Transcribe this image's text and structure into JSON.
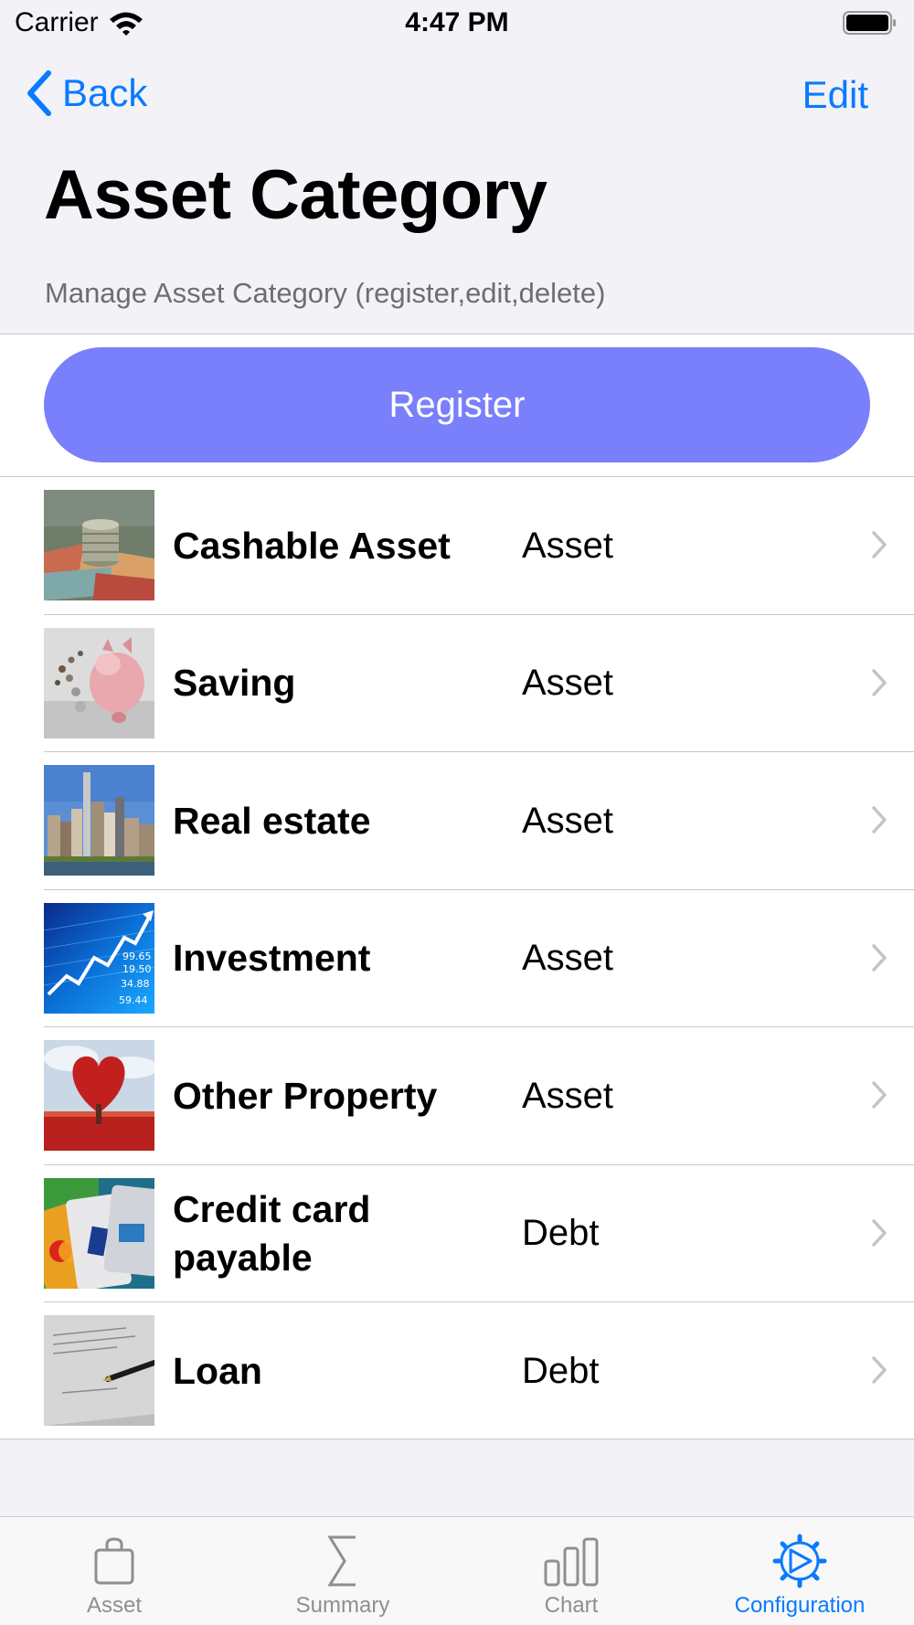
{
  "status_bar": {
    "carrier": "Carrier",
    "time": "4:47 PM"
  },
  "nav": {
    "back_label": "Back",
    "edit_label": "Edit",
    "title": "Asset Category"
  },
  "subtitle": "Manage Asset Category (register,edit,delete)",
  "register_label": "Register",
  "colors": {
    "accent": "#0a7aff",
    "register_button": "#7a7ffb",
    "background": "#f2f2f7"
  },
  "categories": [
    {
      "name": "Cashable Asset",
      "type": "Asset",
      "thumbnail": "cash-image"
    },
    {
      "name": "Saving",
      "type": "Asset",
      "thumbnail": "piggy-bank-image"
    },
    {
      "name": "Real estate",
      "type": "Asset",
      "thumbnail": "city-skyline-image"
    },
    {
      "name": "Investment",
      "type": "Asset",
      "thumbnail": "stock-chart-image"
    },
    {
      "name": "Other Property",
      "type": "Asset",
      "thumbnail": "heart-tree-image"
    },
    {
      "name": "Credit card payable",
      "type": "Debt",
      "thumbnail": "credit-cards-image"
    },
    {
      "name": "Loan",
      "type": "Debt",
      "thumbnail": "signature-document-image"
    }
  ],
  "thumb_text": {
    "investment_numbers": [
      "99.65",
      "19.50",
      "34.88",
      "59.44"
    ]
  },
  "tabs": [
    {
      "label": "Asset",
      "icon": "bag-icon",
      "active": false
    },
    {
      "label": "Summary",
      "icon": "sigma-icon",
      "active": false
    },
    {
      "label": "Chart",
      "icon": "bar-chart-icon",
      "active": false
    },
    {
      "label": "Configuration",
      "icon": "gear-icon",
      "active": true
    }
  ]
}
